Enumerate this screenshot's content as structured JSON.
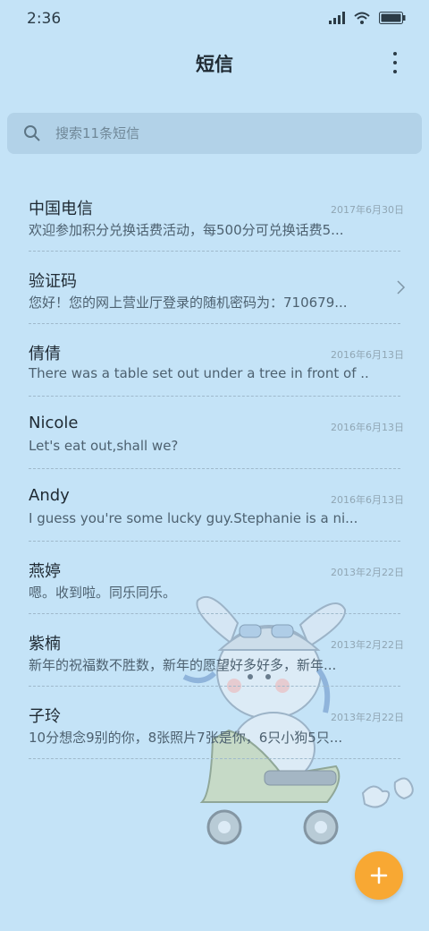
{
  "status_bar": {
    "time": "2:36"
  },
  "header": {
    "title": "短信"
  },
  "search": {
    "placeholder": "搜索11条短信"
  },
  "conversations": [
    {
      "name": "中国电信",
      "date": "2017年6月30日",
      "preview": "欢迎参加积分兑换话费活动，每500分可兑换话费5..."
    },
    {
      "name": "验证码",
      "date": "",
      "preview": "您好！您的网上营业厅登录的随机密码为：710679..."
    },
    {
      "name": "倩倩",
      "date": "2016年6月13日",
      "preview": "There was a table set out under a tree in front of ..."
    },
    {
      "name": "Nicole",
      "date": "2016年6月13日",
      "preview": "Let's eat out,shall we?"
    },
    {
      "name": "Andy",
      "date": "2016年6月13日",
      "preview": "I guess you're some lucky guy.Stephanie is a ni..."
    },
    {
      "name": "燕婷",
      "date": "2013年2月22日",
      "preview": "嗯。收到啦。同乐同乐。"
    },
    {
      "name": "紫楠",
      "date": "2013年2月22日",
      "preview": "新年的祝福数不胜数，新年的愿望好多好多，新年..."
    },
    {
      "name": "子玲",
      "date": "2013年2月22日",
      "preview": "10分想念9别的你，8张照片7张是你，6只小狗5只..."
    }
  ],
  "colors": {
    "background": "#c4e3f7",
    "fab": "#f8a833",
    "search_bg": "#b2d2e8"
  },
  "icons": [
    "signal-icon",
    "wifi-icon",
    "battery-icon",
    "more-icon",
    "search-icon",
    "chevron-right-icon",
    "plus-icon"
  ]
}
